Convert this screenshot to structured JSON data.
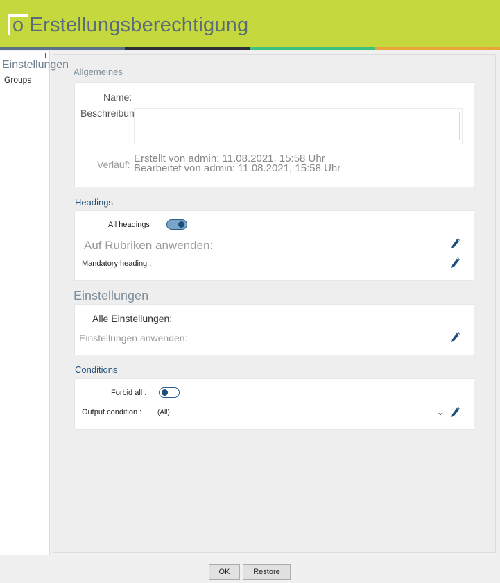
{
  "header": {
    "title": "o Erstellungsberechtigung"
  },
  "stripe_colors": [
    "#5a7186",
    "#2b2f35",
    "#3fc07d",
    "#e8a53a"
  ],
  "sidebar": {
    "tab_title": "Einstellungen",
    "items": [
      {
        "label": "Groups"
      }
    ]
  },
  "general": {
    "title": "Allgemeines",
    "name_label": "Name:",
    "description_label": "Beschreibung:",
    "history_label": "Verlauf:",
    "created": "Erstellt von admin: 11.08.2021. 15:58 Uhr",
    "edited": "Bearbeitet von admin: 11.08.2021, 15:58 Uhr"
  },
  "headings": {
    "title": "Headings",
    "all_label": "All headings :",
    "all_enabled": true,
    "apply_label": "Auf Rubriken anwenden:",
    "mandatory_label": "Mandatory heading :"
  },
  "settings": {
    "title": "Einstellungen",
    "all_label": "Alle Einstellungen:",
    "apply_label": "Einstellungen anwenden:"
  },
  "conditions": {
    "title": "Conditions",
    "forbid_label": "Forbid all :",
    "forbid_enabled": false,
    "output_label": "Output condition :",
    "output_value": "(All)"
  },
  "footer": {
    "ok": "OK",
    "restore": "Restore"
  },
  "icons": {
    "edit": "pencil-icon",
    "dropdown": "chevron-down-icon"
  },
  "colors": {
    "header": "#c5d83e",
    "accent": "#24527a",
    "toggle_on": "#7aa5c9"
  }
}
